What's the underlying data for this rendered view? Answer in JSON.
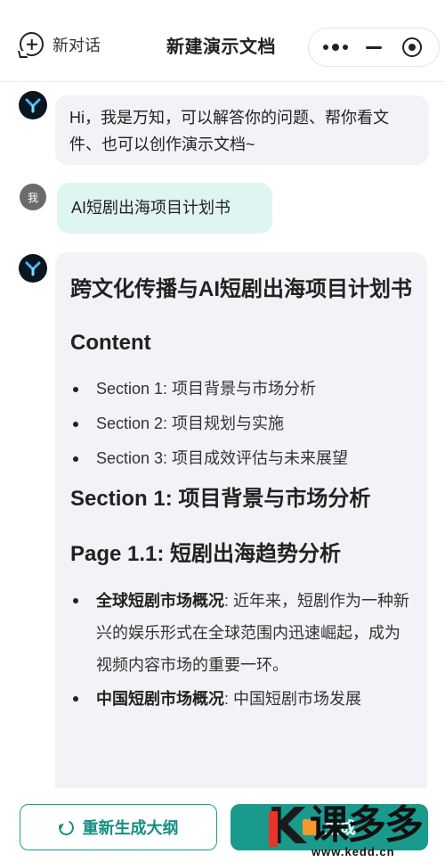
{
  "header": {
    "new_chat_label": "新对话",
    "title": "新建演示文档"
  },
  "chat": {
    "greeting": "Hi，我是万知，可以解答你的问题、帮你看文件、也可以创作演示文档~",
    "user_avatar_label": "我",
    "user_message": "AI短剧出海项目计划书"
  },
  "document": {
    "title": "跨文化传播与AI短剧出海项目计划书",
    "content_heading": "Content",
    "toc": [
      "Section 1: 项目背景与市场分析",
      "Section 2: 项目规划与实施",
      "Section 3: 项目成效评估与未来展望"
    ],
    "section1_heading": "Section 1: 项目背景与市场分析",
    "page_heading": "Page 1.1: 短剧出海趋势分析",
    "bullets": [
      {
        "label": "全球短剧市场概况",
        "text": ": 近年来，短剧作为一种新兴的娱乐形式在全球范围内迅速崛起，成为视频内容市场的重要一环。"
      },
      {
        "label": "中国短剧市场概况",
        "text": ": 中国短剧市场发展"
      }
    ]
  },
  "footer": {
    "regenerate_label": "重新生成大纲",
    "generate_label": "生成"
  },
  "watermark": {
    "logo_text": "课多多",
    "url": "www.kedd.cn"
  },
  "colors": {
    "accent": "#1a9a8c",
    "user_bubble": "#dff5f1",
    "bot_bubble": "#f2f3f7"
  }
}
